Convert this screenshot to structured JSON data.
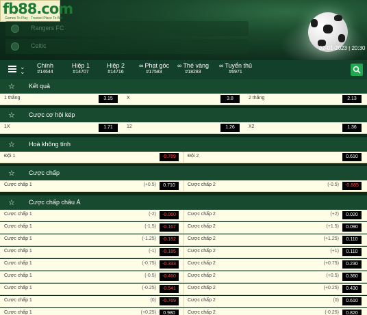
{
  "brand": {
    "logo": "fb88.com",
    "tagline": "Games To Play · Trusted Place To Bet"
  },
  "match": {
    "home_team": "Rangers FC",
    "away_team": "Celtic",
    "datetime": "02-01-2023 | 20:30"
  },
  "tabs": [
    {
      "label": "Chính",
      "count": "#14644",
      "icon": ""
    },
    {
      "label": "Hiệp 1",
      "count": "#14707",
      "icon": ""
    },
    {
      "label": "Hiệp 2",
      "count": "#14716",
      "icon": ""
    },
    {
      "label": "Phạt góc",
      "count": "#17583",
      "icon": "link-icon"
    },
    {
      "label": "Thẻ vàng",
      "count": "#18283",
      "icon": "link-icon"
    },
    {
      "label": "Tuyển thủ",
      "count": "#6971",
      "icon": "link-icon"
    }
  ],
  "colors": {
    "accent": "#1fa84e",
    "header_bg": "#174a2f",
    "row_bg": "#fffde6",
    "negative": "#ff4a4a"
  },
  "markets": {
    "ket_qua": {
      "title": "Kết quả",
      "items": [
        {
          "label": "1 thắng",
          "odd": "3.15"
        },
        {
          "label": "X",
          "odd": "3.8"
        },
        {
          "label": "2 thắng",
          "odd": "2.13"
        }
      ]
    },
    "cuoc_co_hoi_kep": {
      "title": "Cược cơ hội kép",
      "items": [
        {
          "label": "1X",
          "odd": "1.71"
        },
        {
          "label": "12",
          "odd": "1.26"
        },
        {
          "label": "X2",
          "odd": "1.36"
        }
      ]
    },
    "hoa_khong_tinh": {
      "title": "Hoà không tính",
      "items": [
        {
          "label": "Đội 1",
          "odd": "-0.769"
        },
        {
          "label": "Đội 2",
          "odd": "0.610"
        }
      ]
    },
    "cuoc_chap": {
      "title": "Cược chấp",
      "rows": [
        {
          "l_label": "Cược chấp 1",
          "l_hcp": "(+0.5)",
          "l_odd": "0.710",
          "r_label": "Cược chấp 2",
          "r_hcp": "(-0.5)",
          "r_odd": "-0.885"
        }
      ]
    },
    "cuoc_chap_chau_a": {
      "title": "Cược chấp châu Á",
      "rows": [
        {
          "l_label": "Cược chấp 1",
          "l_hcp": "(-2)",
          "l_odd": "-0.060",
          "r_label": "Cược chấp 2",
          "r_hcp": "(+2)",
          "r_odd": "0.020"
        },
        {
          "l_label": "Cược chấp 1",
          "l_hcp": "(-1.5)",
          "l_odd": "-0.167",
          "r_label": "Cược chấp 2",
          "r_hcp": "(+1.5)",
          "r_odd": "0.090"
        },
        {
          "l_label": "Cược chấp 1",
          "l_hcp": "(-1.25)",
          "l_odd": "-0.182",
          "r_label": "Cược chấp 2",
          "r_hcp": "(+1.25)",
          "r_odd": "0.110"
        },
        {
          "l_label": "Cược chấp 1",
          "l_hcp": "(-1)",
          "l_odd": "-0.185",
          "r_label": "Cược chấp 2",
          "r_hcp": "(+1)",
          "r_odd": "0.110"
        },
        {
          "l_label": "Cược chấp 1",
          "l_hcp": "(-0.75)",
          "l_odd": "-0.333",
          "r_label": "Cược chấp 2",
          "r_hcp": "(+0.75)",
          "r_odd": "0.230"
        },
        {
          "l_label": "Cược chấp 1",
          "l_hcp": "(-0.5)",
          "l_odd": "-0.460",
          "r_label": "Cược chấp 2",
          "r_hcp": "(+0.5)",
          "r_odd": "0.360"
        },
        {
          "l_label": "Cược chấp 1",
          "l_hcp": "(-0.25)",
          "l_odd": "-0.541",
          "r_label": "Cược chấp 2",
          "r_hcp": "(+0.25)",
          "r_odd": "0.430"
        },
        {
          "l_label": "Cược chấp 1",
          "l_hcp": "(0)",
          "l_odd": "-0.769",
          "r_label": "Cược chấp 2",
          "r_hcp": "(0)",
          "r_odd": "0.610"
        },
        {
          "l_label": "Cược chấp 1",
          "l_hcp": "(+0.25)",
          "l_odd": "0.980",
          "r_label": "Cược chấp 2",
          "r_hcp": "(-0.25)",
          "r_odd": "0.820"
        }
      ]
    }
  }
}
